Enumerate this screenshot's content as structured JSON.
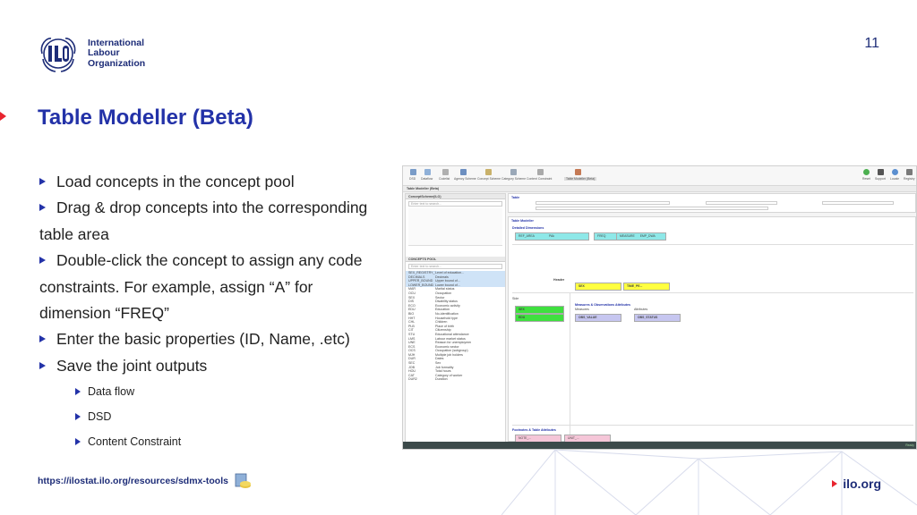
{
  "header": {
    "logo_line1": "International",
    "logo_line2": "Labour",
    "logo_line3": "Organization",
    "page_number": "11",
    "title": "Table Modeller (Beta)"
  },
  "bullets": [
    {
      "line1": "Load concepts in the concept pool"
    },
    {
      "line1": "Drag & drop concepts into the corresponding",
      "line2": "table area"
    },
    {
      "line1": "Double-click the concept to assign any code",
      "line2": "constraints. For example, assign “A” for",
      "line3": "dimension “FREQ”"
    },
    {
      "line1": "Enter the basic properties (ID, Name, .etc)"
    },
    {
      "line1": "Save the joint outputs"
    }
  ],
  "sub_bullets": [
    "Data flow",
    "DSD",
    "Content Constraint"
  ],
  "footer": {
    "url": "https://ilostat.ilo.org/resources/sdmx-tools",
    "brand": "ilo.org"
  },
  "colors": {
    "title": "#2332a8",
    "accent_red": "#e8242f",
    "dark_blue": "#1e2d78",
    "dim_cyan": "#8ee8e8",
    "measure_violet": "#c6c6f0",
    "attr_pink": "#f5c6d8",
    "obs_green": "#3fe03f",
    "time_yellow": "#ffff40"
  },
  "screenshot": {
    "toolbar_labels": [
      "DSD",
      "Dataflow",
      "Codelist",
      "Agency Scheme",
      "Concept Scheme",
      "Category Scheme",
      "Content Constraint",
      "Table Modeller (Beta)"
    ],
    "toolbar_right": [
      "Reset",
      "Support",
      "Locale",
      "Registry"
    ],
    "appbar_tab": "Table Modeller (Beta)",
    "left_panel_title": "ConceptScheme(ILO)",
    "concept_pool_title": "CONCEPTS POOL",
    "search_placeholder": "Enter text to search...",
    "search_button": "Find",
    "pool_rows": [
      [
        "SEX_REGISTRY_TYPE",
        "Level of education..."
      ],
      [
        "DECIMALS",
        "Decimals"
      ],
      [
        "UPPER_BOUND",
        "Upper bound of..."
      ],
      [
        "LOWER_BOUND",
        "Lower bound of..."
      ],
      [
        "MAR",
        "Marital status"
      ],
      [
        "OCU",
        "Occupation"
      ],
      [
        "SEX",
        "Sector"
      ],
      [
        "DIS",
        "Disability status"
      ],
      [
        "ECO",
        "Economic activity"
      ],
      [
        "EDU",
        "Education"
      ],
      [
        "BIO",
        "No-identification"
      ],
      [
        "HHT",
        "Household type"
      ],
      [
        "CHL",
        "Children"
      ],
      [
        "PLB",
        "Place of birth"
      ],
      [
        "CIT",
        "Citizenship"
      ],
      [
        "STU",
        "Educational attendance"
      ],
      [
        "LMS",
        "Labour market status"
      ],
      [
        "UNE",
        "Reason for unemployment"
      ],
      [
        "ECS",
        "Economic sector"
      ],
      [
        "OCS",
        "Occupation (subgroup)"
      ],
      [
        "MJH",
        "Multiple job holders"
      ],
      [
        "DUR",
        "Dates"
      ],
      [
        "SEC",
        "Sex"
      ],
      [
        "JOB",
        "Job formality"
      ],
      [
        "HOU",
        "Total hours"
      ],
      [
        "CAT",
        "Category of worker"
      ],
      [
        "DUR2",
        "Duration"
      ]
    ],
    "table_label": "Table",
    "table_modeller_label": "Table Modeller",
    "detailed_dimensions": "Detailed Dimensions",
    "dimension_boxes": [
      "REF_AREA",
      "FREQ",
      "MEASURE"
    ],
    "dimension_values": [
      "PAk",
      "A",
      "EMP_DWA"
    ],
    "header_label": "Header",
    "time_box": "SEX",
    "time_value": "TIME_PE...",
    "side_label": "Side",
    "obs_boxes": [
      "SEX",
      "EDU"
    ],
    "measures_title": "Measures & Observations Attributes",
    "measures_label": "Measures",
    "attribute_label": "Attributes",
    "measure_box": "OBS_VALUE",
    "attr_box": "OBS_STATUS",
    "footnotes_title": "Footnotes & Table Attributes",
    "footnote_boxes": [
      "NOTE_...",
      "UNIT_..."
    ],
    "status_text": "Ready"
  }
}
